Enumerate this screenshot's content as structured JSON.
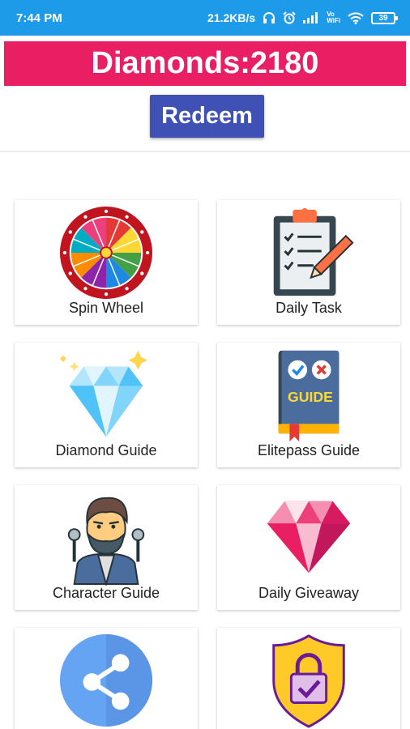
{
  "status_bar": {
    "time": "7:44 PM",
    "speed": "21.2KB/s",
    "battery": "39",
    "vo": "Vo",
    "wifi": "WiFi",
    "color": "#1e9be8"
  },
  "header": {
    "diamonds": "Diamonds:2180",
    "redeem_label": "Redeem",
    "banner_color": "#e91e63",
    "button_color": "#3f51b5"
  },
  "menu": [
    {
      "label": "Spin Wheel",
      "icon": "spin-wheel-icon"
    },
    {
      "label": "Daily Task",
      "icon": "clipboard-icon"
    },
    {
      "label": "Diamond Guide",
      "icon": "blue-diamond-icon"
    },
    {
      "label": "Elitepass Guide",
      "icon": "guide-book-icon",
      "book_text": "GUIDE"
    },
    {
      "label": "Character Guide",
      "icon": "character-icon"
    },
    {
      "label": "Daily Giveaway",
      "icon": "pink-diamond-icon"
    },
    {
      "label": "",
      "icon": "share-icon"
    },
    {
      "label": "",
      "icon": "lock-shield-icon"
    }
  ]
}
